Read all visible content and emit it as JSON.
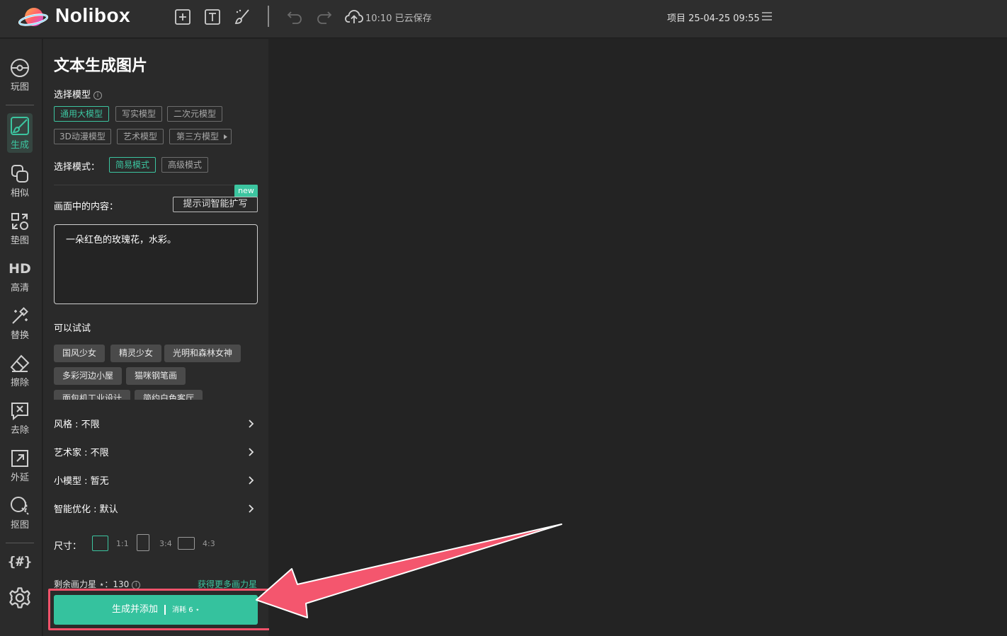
{
  "app": {
    "brand": "Nolibox",
    "save_status": "10:10 已云保存",
    "project_title": "项目 25-04-25 09:55"
  },
  "nav": [
    {
      "label": "玩图",
      "icon": "play-image-icon"
    },
    {
      "label": "生成",
      "icon": "generate-brush-icon",
      "active": true
    },
    {
      "label": "相似",
      "icon": "similar-icon"
    },
    {
      "label": "垫图",
      "icon": "pad-image-icon"
    },
    {
      "label": "高清",
      "icon": "hd-icon",
      "glyph": "HD"
    },
    {
      "label": "替换",
      "icon": "replace-wand-icon"
    },
    {
      "label": "擦除",
      "icon": "eraser-icon"
    },
    {
      "label": "去除",
      "icon": "remove-icon"
    },
    {
      "label": "外延",
      "icon": "outpaint-icon"
    },
    {
      "label": "抠图",
      "icon": "cutout-icon"
    }
  ],
  "nav_extra": {
    "hash_glyph": "{#}"
  },
  "panel": {
    "title": "文本生成图片",
    "model_label": "选择模型",
    "models": [
      "通用大模型",
      "写实模型",
      "二次元模型",
      "3D动漫模型",
      "艺术模型",
      "第三方模型"
    ],
    "active_model": "通用大模型",
    "mode_label": "选择模式：",
    "modes": [
      "简易模式",
      "高级模式"
    ],
    "active_mode": "简易模式",
    "content_label": "画面中的内容：",
    "new_badge": "new",
    "expand_button": "提示词智能扩写",
    "prompt_value": "一朵红色的玫瑰花，水彩。",
    "try_label": "可以试试",
    "suggestions": [
      "国风少女",
      "精灵少女",
      "光明和森林女神",
      "多彩河边小屋",
      "猫咪钢笔画",
      "面包机工业设计",
      "简约白色客厅"
    ],
    "options": [
      {
        "label": "风格 : 不限"
      },
      {
        "label": "艺术家 : 不限"
      },
      {
        "label": "小模型 : 暂无"
      },
      {
        "label": "智能优化 : 默认"
      }
    ],
    "size_label": "尺寸：",
    "sizes": [
      "1:1",
      "3:4",
      "4:3"
    ],
    "active_size": "1:1",
    "credits_text": "剩余画力星 ⋆：130",
    "get_more": "获得更多画力星",
    "generate_button": "生成并添加",
    "generate_cost": "消耗 6 ⋆"
  },
  "colors": {
    "accent": "#3cc5a0",
    "highlight": "#f0526a",
    "panel_bg": "#2a2a2a",
    "canvas_bg": "#232323"
  }
}
